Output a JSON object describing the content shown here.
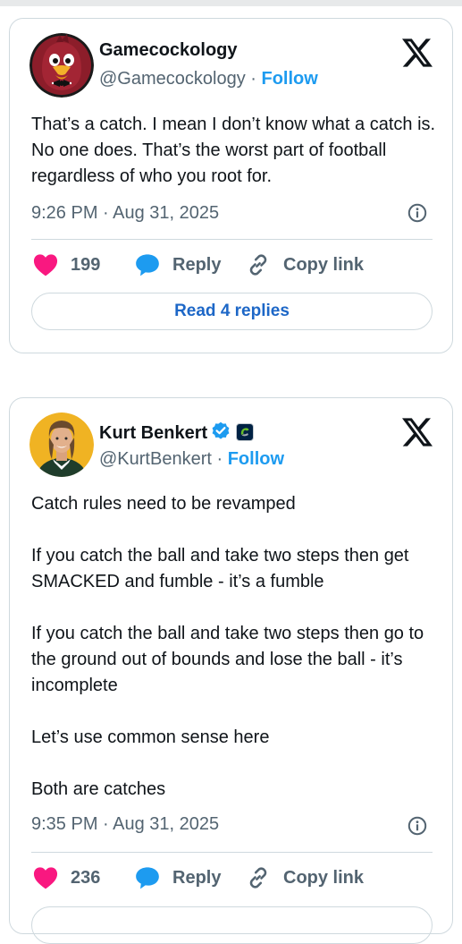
{
  "tweets": [
    {
      "author": {
        "name": "Gamecockology",
        "handle": "@Gamecockology",
        "verified": false,
        "avatar_icon": "gamecock-mascot-avatar"
      },
      "follow_label": "Follow",
      "separator": "·",
      "body": [
        "That’s a catch. I mean I don’t know what a catch is. No one does. That’s the worst part of football regardless of who you root for."
      ],
      "timestamp": "9:26 PM · Aug 31, 2025",
      "likes": "199",
      "reply_label": "Reply",
      "copy_label": "Copy link",
      "read_replies_label": "Read 4 replies"
    },
    {
      "author": {
        "name": "Kurt Benkert",
        "handle": "@KurtBenkert",
        "verified": true,
        "avatar_icon": "profile-photo-avatar"
      },
      "follow_label": "Follow",
      "separator": "·",
      "body": [
        "Catch rules need to be revamped",
        "If you catch the ball and take two steps then get SMACKED and fumble - it’s a fumble",
        "If you catch the ball and take two steps then go to the ground out of bounds and lose the ball - it’s incomplete",
        "Let’s use common sense here",
        "Both are catches"
      ],
      "timestamp": "9:35 PM · Aug 31, 2025",
      "likes": "236",
      "reply_label": "Reply",
      "copy_label": "Copy link"
    }
  ],
  "colors": {
    "accent": "#1d9bf0",
    "heart": "#f91880",
    "reply_bubble": "#1d9bf0",
    "border": "#cfd9de",
    "muted": "#536471"
  },
  "icons": [
    "x-logo-icon",
    "verified-badge-icon",
    "affiliate-badge-icon",
    "heart-icon",
    "reply-bubble-icon",
    "link-icon",
    "info-icon"
  ]
}
